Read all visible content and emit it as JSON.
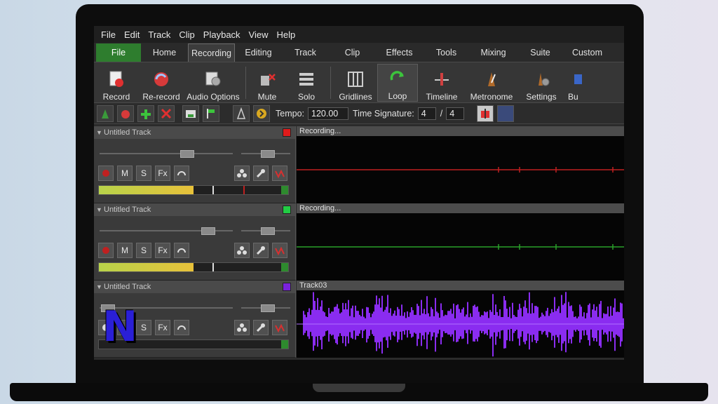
{
  "menu": [
    "File",
    "Edit",
    "Track",
    "Clip",
    "Playback",
    "View",
    "Help"
  ],
  "tabs": [
    {
      "label": "File",
      "style": "file"
    },
    {
      "label": "Home",
      "style": ""
    },
    {
      "label": "Recording",
      "style": "active"
    },
    {
      "label": "Editing",
      "style": ""
    },
    {
      "label": "Track",
      "style": ""
    },
    {
      "label": "Clip",
      "style": ""
    },
    {
      "label": "Effects",
      "style": ""
    },
    {
      "label": "Tools",
      "style": ""
    },
    {
      "label": "Mixing",
      "style": ""
    },
    {
      "label": "Suite",
      "style": ""
    },
    {
      "label": "Custom",
      "style": ""
    }
  ],
  "ribbon": {
    "record": "Record",
    "rerecord": "Re-record",
    "audio_options": "Audio Options",
    "mute": "Mute",
    "solo": "Solo",
    "gridlines": "Gridlines",
    "loop": "Loop",
    "timeline": "Timeline",
    "metronome": "Metronome",
    "settings": "Settings",
    "buy": "Bu"
  },
  "toolbar2": {
    "tempo_label": "Tempo:",
    "tempo_value": "120.00",
    "timesig_label": "Time Signature:",
    "timesig_num": "4",
    "timesig_sep": "/",
    "timesig_den": "4"
  },
  "tracks": [
    {
      "name": "Untitled Track",
      "color": "#e01b1b",
      "clip_title": "Recording...",
      "mute": "M",
      "solo": "S",
      "fx": "Fx",
      "wave_color": "#c02020"
    },
    {
      "name": "Untitled Track",
      "color": "#22cc44",
      "clip_title": "Recording...",
      "mute": "M",
      "solo": "S",
      "fx": "Fx",
      "wave_color": "#2aa02a"
    },
    {
      "name": "Untitled Track",
      "color": "#7a22dd",
      "clip_title": "Track03",
      "mute": "M",
      "solo": "S",
      "fx": "Fx",
      "wave_color": "#8a2cf0"
    }
  ],
  "logo": {
    "letter": "N"
  }
}
